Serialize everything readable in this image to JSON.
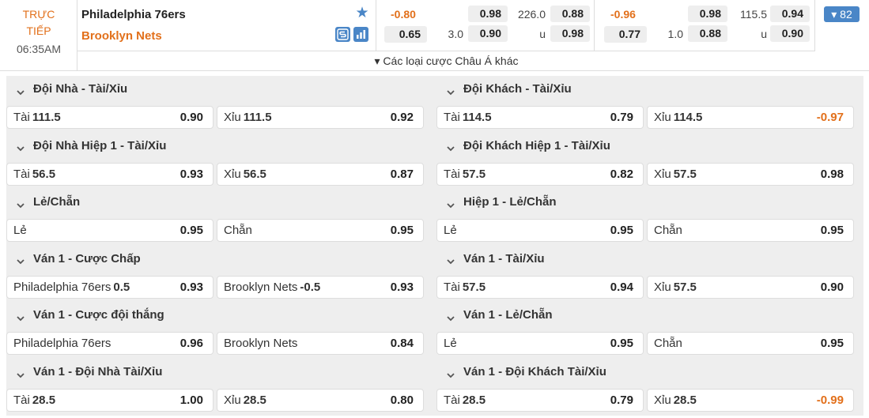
{
  "header": {
    "live_line1": "TRỰC",
    "live_line2": "TIẾP",
    "time": "06:35AM",
    "home_team": "Philadelphia 76ers",
    "away_team": "Brooklyn Nets",
    "other_bets": "▾ Các loại cược Châu Á khác",
    "more_count": "▾ 82",
    "full_time": {
      "row1": {
        "hdp": "-0.80",
        "hdp_odds": "0.98",
        "total": "226.0",
        "total_odds": "0.88"
      },
      "row2": {
        "hdp": "0.65",
        "hdp_line": "3.0",
        "hdp_odds": "0.90",
        "total_label": "u",
        "total_odds": "0.98"
      }
    },
    "half": {
      "row1": {
        "hdp": "-0.96",
        "hdp_odds": "0.98",
        "total": "115.5",
        "total_odds": "0.94"
      },
      "row2": {
        "hdp": "0.77",
        "hdp_line": "1.0",
        "hdp_odds": "0.88",
        "total_label": "u",
        "total_odds": "0.90"
      }
    }
  },
  "markets": [
    {
      "title": "Đội Nhà - Tài/Xỉu",
      "options": [
        {
          "label": "Tài",
          "line": "111.5",
          "odds": "0.90"
        },
        {
          "label": "Xỉu",
          "line": "111.5",
          "odds": "0.92"
        }
      ]
    },
    {
      "title": "Đội Khách - Tài/Xỉu",
      "options": [
        {
          "label": "Tài",
          "line": "114.5",
          "odds": "0.79"
        },
        {
          "label": "Xỉu",
          "line": "114.5",
          "odds": "-0.97"
        }
      ]
    },
    {
      "title": "Đội Nhà Hiệp 1 - Tài/Xỉu",
      "options": [
        {
          "label": "Tài",
          "line": "56.5",
          "odds": "0.93"
        },
        {
          "label": "Xỉu",
          "line": "56.5",
          "odds": "0.87"
        }
      ]
    },
    {
      "title": "Đội Khách Hiệp 1 - Tài/Xỉu",
      "options": [
        {
          "label": "Tài",
          "line": "57.5",
          "odds": "0.82"
        },
        {
          "label": "Xỉu",
          "line": "57.5",
          "odds": "0.98"
        }
      ]
    },
    {
      "title": "Lẻ/Chẵn",
      "options": [
        {
          "label": "Lẻ",
          "line": "",
          "odds": "0.95"
        },
        {
          "label": "Chẵn",
          "line": "",
          "odds": "0.95"
        }
      ]
    },
    {
      "title": "Hiệp 1 - Lẻ/Chẵn",
      "options": [
        {
          "label": "Lẻ",
          "line": "",
          "odds": "0.95"
        },
        {
          "label": "Chẵn",
          "line": "",
          "odds": "0.95"
        }
      ]
    },
    {
      "title": "Ván 1 - Cược Chấp",
      "options": [
        {
          "label": "Philadelphia 76ers",
          "line": "0.5",
          "odds": "0.93"
        },
        {
          "label": "Brooklyn Nets",
          "line": "-0.5",
          "odds": "0.93"
        }
      ]
    },
    {
      "title": "Ván 1 - Tài/Xỉu",
      "options": [
        {
          "label": "Tài",
          "line": "57.5",
          "odds": "0.94"
        },
        {
          "label": "Xỉu",
          "line": "57.5",
          "odds": "0.90"
        }
      ]
    },
    {
      "title": "Ván 1 - Cược đội thắng",
      "options": [
        {
          "label": "Philadelphia 76ers",
          "line": "",
          "odds": "0.96"
        },
        {
          "label": "Brooklyn Nets",
          "line": "",
          "odds": "0.84"
        }
      ]
    },
    {
      "title": "Ván 1 - Lẻ/Chẵn",
      "options": [
        {
          "label": "Lẻ",
          "line": "",
          "odds": "0.95"
        },
        {
          "label": "Chẵn",
          "line": "",
          "odds": "0.95"
        }
      ]
    },
    {
      "title": "Ván 1 - Đội Nhà Tài/Xỉu",
      "options": [
        {
          "label": "Tài",
          "line": "28.5",
          "odds": "1.00"
        },
        {
          "label": "Xỉu",
          "line": "28.5",
          "odds": "0.80"
        }
      ]
    },
    {
      "title": "Ván 1 - Đội Khách Tài/Xỉu",
      "options": [
        {
          "label": "Tài",
          "line": "28.5",
          "odds": "0.79"
        },
        {
          "label": "Xỉu",
          "line": "28.5",
          "odds": "-0.99"
        }
      ]
    }
  ],
  "colors": {
    "accent": "#e2701b",
    "brand_blue": "#4a86c7",
    "panel_bg": "#eeeeee"
  },
  "icons": {
    "favorite": "star-icon",
    "stats_s": "s-stats-icon",
    "chart": "bar-chart-icon",
    "collapse": "chevron-down-icon"
  }
}
